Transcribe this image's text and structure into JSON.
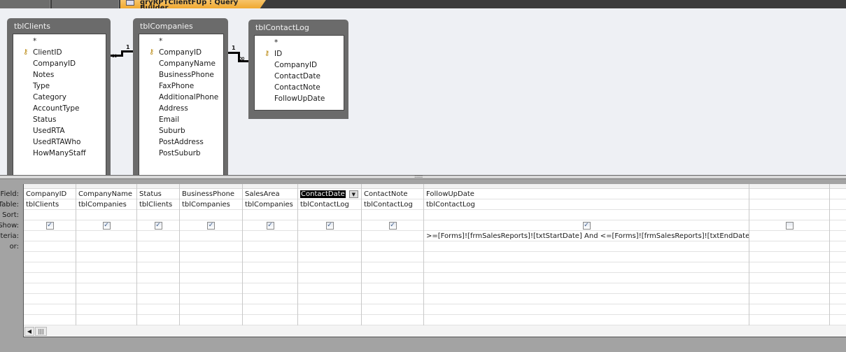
{
  "tabs": {
    "active_label": "qryRPTClientFUp : Query Builder"
  },
  "tables": [
    {
      "name": "tblClients",
      "fields": [
        "*",
        "ClientID",
        "CompanyID",
        "Notes",
        "Type",
        "Category",
        "AccountType",
        "Status",
        "UsedRTA",
        "UsedRTAWho",
        "HowManyStaff"
      ],
      "key": "ClientID"
    },
    {
      "name": "tblCompanies",
      "fields": [
        "*",
        "CompanyID",
        "CompanyName",
        "BusinessPhone",
        "FaxPhone",
        "AdditionalPhone",
        "Address",
        "Email",
        "Suburb",
        "PostAddress",
        "PostSuburb"
      ],
      "key": "CompanyID"
    },
    {
      "name": "tblContactLog",
      "fields": [
        "*",
        "ID",
        "CompanyID",
        "ContactDate",
        "ContactNote",
        "FollowUpDate"
      ],
      "key": "ID"
    }
  ],
  "relationships": {
    "one": "1",
    "many": "∞"
  },
  "row_headers": [
    "Field:",
    "Table:",
    "Sort:",
    "Show:",
    "Criteria:",
    "or:"
  ],
  "columns": [
    {
      "field": "CompanyID",
      "table": "tblClients",
      "show": true,
      "criteria": ""
    },
    {
      "field": "CompanyName",
      "table": "tblCompanies",
      "show": true,
      "criteria": ""
    },
    {
      "field": "Status",
      "table": "tblClients",
      "show": true,
      "criteria": ""
    },
    {
      "field": "BusinessPhone",
      "table": "tblCompanies",
      "show": true,
      "criteria": ""
    },
    {
      "field": "SalesArea",
      "table": "tblCompanies",
      "show": true,
      "criteria": ""
    },
    {
      "field": "ContactDate",
      "table": "tblContactLog",
      "show": true,
      "criteria": "",
      "selected": true
    },
    {
      "field": "ContactNote",
      "table": "tblContactLog",
      "show": true,
      "criteria": ""
    },
    {
      "field": "FollowUpDate",
      "table": "tblContactLog",
      "show": true,
      "criteria": ">=[Forms]![frmSalesReports]![txtStartDate] And <=[Forms]![frmSalesReports]![txtEndDate]"
    },
    {
      "field": "",
      "table": "",
      "show": false,
      "criteria": ""
    },
    {
      "field": "",
      "table": "",
      "show": null,
      "criteria": ""
    }
  ],
  "scrollbar": {
    "left_arrow": "◀",
    "thumb": "|||"
  },
  "icons": {
    "key": "key-icon",
    "check": "✓"
  }
}
